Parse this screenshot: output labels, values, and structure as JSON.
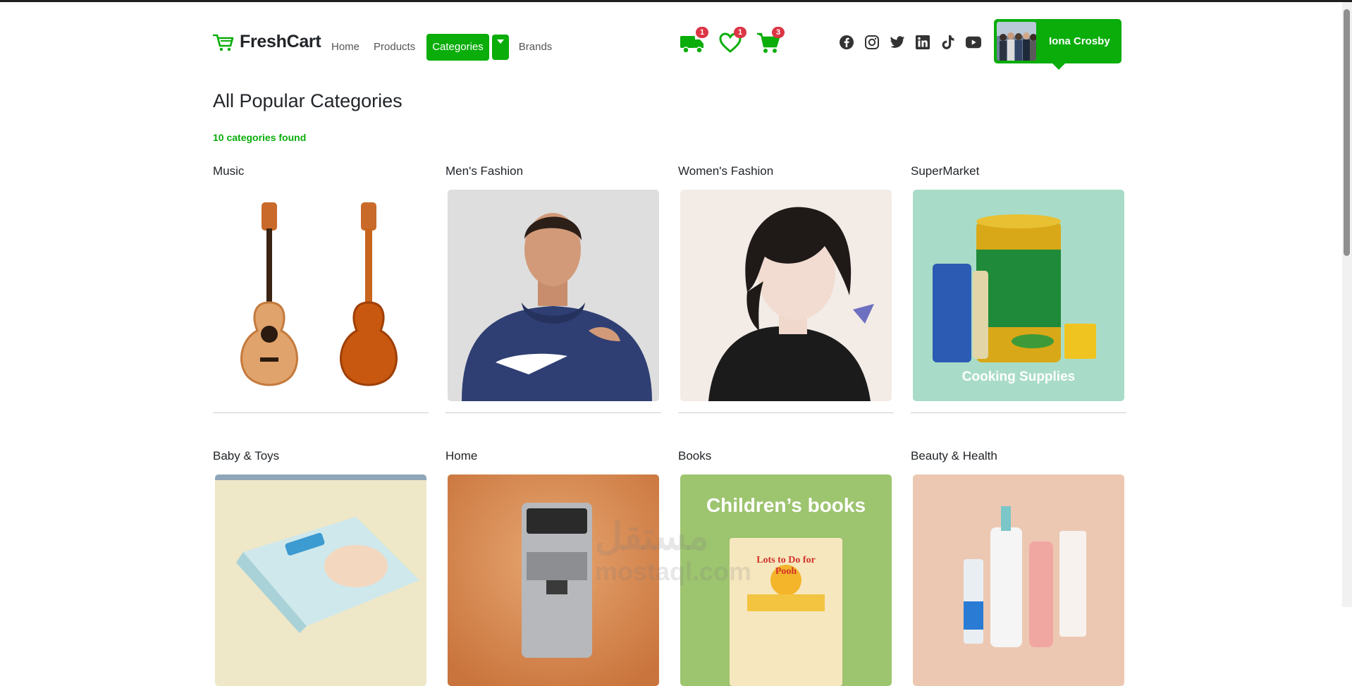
{
  "brand": {
    "name": "FreshCart",
    "accent": "#0aad0a"
  },
  "nav": {
    "links": [
      "Home",
      "Products",
      "Categories",
      "Brands"
    ],
    "active": "Categories"
  },
  "header_icons": [
    {
      "icon": "truck-icon",
      "badge": "1"
    },
    {
      "icon": "heart-icon",
      "badge": "1"
    },
    {
      "icon": "cart-icon",
      "badge": "3"
    }
  ],
  "socials": [
    "facebook-icon",
    "instagram-icon",
    "twitter-icon",
    "linkedin-icon",
    "tiktok-icon",
    "youtube-icon"
  ],
  "user": {
    "name": "Iona Crosby"
  },
  "page": {
    "title": "All Popular Categories",
    "count_text": "10 categories found"
  },
  "categories": [
    {
      "name": "Music"
    },
    {
      "name": "Men's Fashion"
    },
    {
      "name": "Women's Fashion"
    },
    {
      "name": "SuperMarket",
      "caption": "Cooking Supplies"
    },
    {
      "name": "Baby & Toys"
    },
    {
      "name": "Home"
    },
    {
      "name": "Books",
      "caption": "Children’s books",
      "book_title": "Lots to Do for Pooh"
    },
    {
      "name": "Beauty & Health"
    }
  ],
  "watermark": {
    "line1": "مستقل",
    "line2": "mostaql.com"
  }
}
